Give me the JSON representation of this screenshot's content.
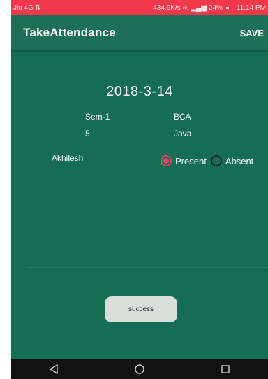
{
  "status_bar": {
    "carrier": "Jio 4G",
    "speed": "434.9K/s",
    "battery": "24%",
    "time": "11:14 PM"
  },
  "app_bar": {
    "title": "TakeAttendance",
    "save_label": "SAVE"
  },
  "attendance": {
    "date": "2018-3-14",
    "semester": "Sem-1",
    "course": "BCA",
    "number": "5",
    "subject": "Java",
    "student": "Akhilesh",
    "options": [
      "Present",
      "Absent"
    ],
    "selected": "Present"
  },
  "toast": {
    "message": "success"
  },
  "nav": {
    "icons": [
      "back-icon",
      "home-icon",
      "recents-icon"
    ]
  },
  "colors": {
    "status_bar": "#f0384a",
    "app_bar": "#1d6f55",
    "background": "#156d53",
    "radio_accent": "#e9436b"
  }
}
